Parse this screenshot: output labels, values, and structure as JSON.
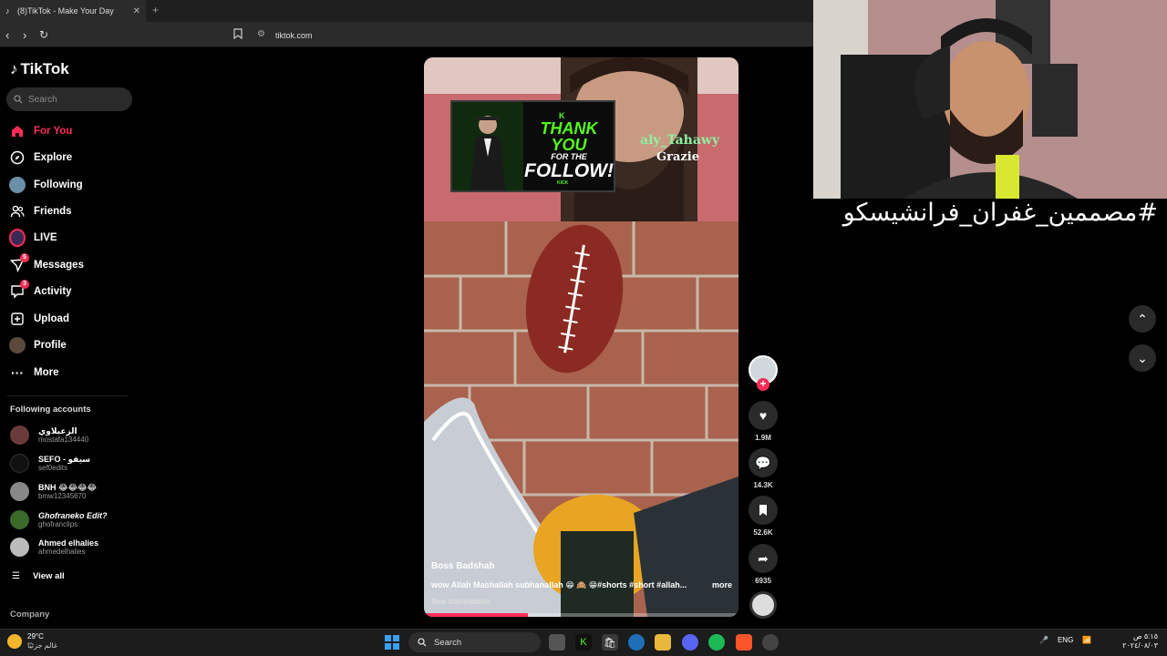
{
  "browser": {
    "tab_title": "(8)TikTok - Make Your Day",
    "tab_close": "✕",
    "new_tab": "+",
    "url": "tiktok.com"
  },
  "sidebar": {
    "logo": "TikTok",
    "search_placeholder": "Search",
    "nav": [
      {
        "label": "For You",
        "icon": "home-icon"
      },
      {
        "label": "Explore",
        "icon": "compass-icon"
      },
      {
        "label": "Following",
        "icon": "following-icon"
      },
      {
        "label": "Friends",
        "icon": "friends-icon"
      },
      {
        "label": "LIVE",
        "icon": "live-icon"
      },
      {
        "label": "Messages",
        "icon": "messages-icon",
        "badge": "5"
      },
      {
        "label": "Activity",
        "icon": "activity-icon",
        "badge": "3"
      },
      {
        "label": "Upload",
        "icon": "upload-icon"
      },
      {
        "label": "Profile",
        "icon": "profile-icon"
      },
      {
        "label": "More",
        "icon": "more-icon"
      }
    ],
    "following_title": "Following accounts",
    "accounts": [
      {
        "name": "الزعبلاوي",
        "handle": "mostafa134440"
      },
      {
        "name": "SEFO - سيفو",
        "handle": "sef0edits"
      },
      {
        "name": "BNH 😂😂😂😂",
        "handle": "bmw12345670"
      },
      {
        "name": "Ghofraneko Edit?",
        "handle": "ghofranclips"
      },
      {
        "name": "Ahmed elhalies",
        "handle": "ahmedelhalies"
      }
    ],
    "view_all": "View all",
    "company": "Company"
  },
  "video": {
    "author": "Boss Badshah",
    "description": "wow Allah Mashallah subhanallah 😁 🙈 😁#shorts #short #allah...",
    "more": "more",
    "see_translation": "See translation",
    "progress": 0.33,
    "banner": {
      "line1": "THANK YOU",
      "line2": "FOR THE",
      "line3": "FOLLOW!",
      "brand": "KICK",
      "logo": "K"
    },
    "stream_user": "aly_Tahawy",
    "stream_msg": "Grazie"
  },
  "actions": {
    "likes": "1.9M",
    "comments": "14.3K",
    "saves": "52.6K",
    "shares": "6935"
  },
  "stream_overlay": {
    "hashtag": "#مصممين_غفران_فرانشيسكو"
  },
  "taskbar": {
    "temp": "29°C",
    "condition": "غالم جزئيًا",
    "search": "Search",
    "lang": "ENG",
    "time": "٥:١٥ ص",
    "date": "٢٠٢٤/٠٨/٠٣"
  },
  "colors": {
    "accent": "#fe2c55",
    "kick_green": "#53fc18"
  }
}
